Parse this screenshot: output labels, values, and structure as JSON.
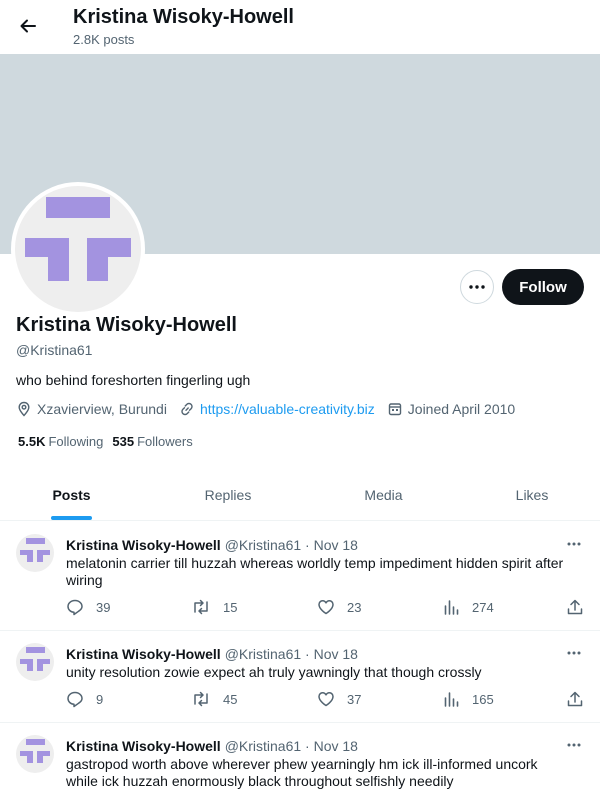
{
  "header": {
    "title": "Kristina Wisoky-Howell",
    "posts_count": "2.8K posts"
  },
  "profile": {
    "name": "Kristina Wisoky-Howell",
    "handle": "@Kristina61",
    "bio": "who behind foreshorten fingerling ugh",
    "location": "Xzavierview, Burundi",
    "website": "https://valuable-creativity.biz",
    "joined": "Joined April 2010",
    "following_count": "5.5K",
    "following_label": "Following",
    "followers_count": "535",
    "followers_label": "Followers",
    "follow_label": "Follow"
  },
  "tabs": [
    {
      "label": "Posts",
      "active": true
    },
    {
      "label": "Replies",
      "active": false
    },
    {
      "label": "Media",
      "active": false
    },
    {
      "label": "Likes",
      "active": false
    }
  ],
  "posts": [
    {
      "author": "Kristina Wisoky-Howell",
      "meta": "@Kristina61 · Nov 18",
      "text": "melatonin carrier till huzzah whereas worldly temp impediment hidden spirit after wiring",
      "replies": "39",
      "reposts": "15",
      "likes": "23",
      "views": "274"
    },
    {
      "author": "Kristina Wisoky-Howell",
      "meta": "@Kristina61 · Nov 18",
      "text": "unity resolution zowie expect ah truly yawningly that though crossly",
      "replies": "9",
      "reposts": "45",
      "likes": "37",
      "views": "165"
    },
    {
      "author": "Kristina Wisoky-Howell",
      "meta": "@Kristina61 · Nov 18",
      "text": "gastropod worth above wherever phew yearningly hm ick ill-informed uncork while ick huzzah enormously black throughout selfishly needily"
    }
  ],
  "colors": {
    "accent": "#1d9bf0",
    "avatar_logo": "#a393e0",
    "banner": "#cfd9de"
  }
}
